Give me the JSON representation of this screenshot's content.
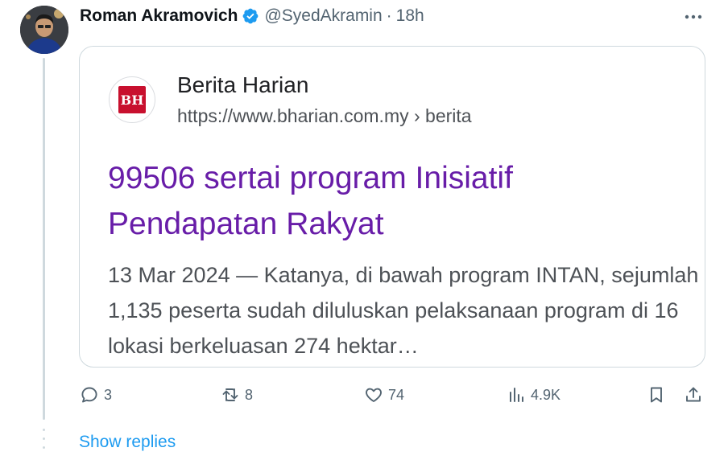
{
  "tweet": {
    "author_name": "Roman Akramovich",
    "handle": "@SyedAkramin",
    "separator": "·",
    "time": "18h"
  },
  "card": {
    "favicon_text": "BH",
    "site_name": "Berita Harian",
    "url_base": "https://www.bharian.com.my",
    "url_path": " › berita",
    "headline": "99506 sertai program Inisiatif Pendapatan Rakyat",
    "snippet": "13 Mar 2024 — Katanya, di bawah program INTAN, sejumlah 1,135 peserta sudah diluluskan pelaksanaan program di 16 lokasi berkeluasan 274 hektar…"
  },
  "actions": {
    "replies": "3",
    "reposts": "8",
    "likes": "74",
    "views": "4.9K"
  },
  "footer": {
    "show_replies": "Show replies"
  },
  "colors": {
    "verified": "#1d9bf0",
    "headline": "#681da8",
    "link": "#1d9bf0",
    "muted": "#536471",
    "favicon_bg": "#c8102e"
  }
}
